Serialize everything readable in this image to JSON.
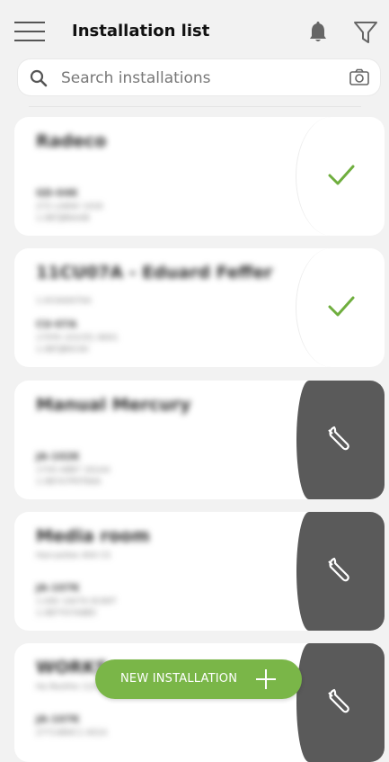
{
  "header": {
    "title": "Installation list"
  },
  "search": {
    "placeholder": "Search installations"
  },
  "installations": [
    {
      "name": "Radeco",
      "line1": "GD-04K",
      "line2": "272 LA8AV 1416",
      "line3": "1.0B7JB6AAB",
      "status": "ok"
    },
    {
      "name": "11CU07A - Eduard Feffer",
      "line0": "1.0C0A0070A",
      "line1": "CU-07A",
      "line2": "170TA 101CE1 8001",
      "line3": "1.0B7JB0CAV",
      "status": "ok"
    },
    {
      "name": "Manual Mercury",
      "line1": "JA-102K",
      "line2": "17V0 A8B7 161AA",
      "line3": "1.0B7A7P0T84A",
      "status": "service"
    },
    {
      "name": "Media room",
      "line0": "Harcastlee 404 CS",
      "line1": "JA-107K",
      "line2": "1.0AV 1AV7A 8190T",
      "line3": "1.0B7Y07A8B5",
      "status": "service"
    },
    {
      "name": "WORKS",
      "line0": "Ha Reshhe 110 CS",
      "line1": "JA-107K",
      "line2": "27714B4C1 A01A",
      "line3": "",
      "status": "service"
    }
  ],
  "fab": {
    "label": "NEW INSTALLATION"
  },
  "colors": {
    "accent": "#7ab648",
    "service": "#5a5a5a",
    "check": "#6fae3e"
  }
}
